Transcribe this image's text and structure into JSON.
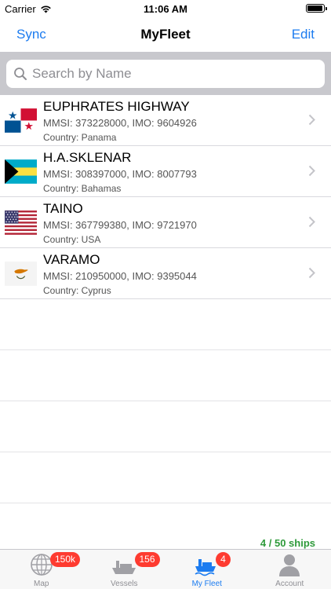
{
  "status": {
    "carrier": "Carrier",
    "time": "11:06 AM"
  },
  "nav": {
    "left": "Sync",
    "title": "MyFleet",
    "right": "Edit"
  },
  "search": {
    "placeholder": "Search by Name",
    "value": ""
  },
  "ships": [
    {
      "name": "EUPHRATES HIGHWAY",
      "ids": "MMSI: 373228000, IMO: 9604926",
      "country": "Country: Panama",
      "flag": "panama-flag"
    },
    {
      "name": "H.A.SKLENAR",
      "ids": "MMSI: 308397000, IMO: 8007793",
      "country": "Country: Bahamas",
      "flag": "bahamas-flag"
    },
    {
      "name": "TAINO",
      "ids": "MMSI: 367799380, IMO: 9721970",
      "country": "Country: USA",
      "flag": "usa-flag"
    },
    {
      "name": "VARAMO",
      "ids": "MMSI: 210950000, IMO: 9395044",
      "country": "Country: Cyprus",
      "flag": "cyprus-flag"
    }
  ],
  "count_text": "4 / 50 ships",
  "tabs": [
    {
      "label": "Map",
      "badge": "150k",
      "icon": "globe-icon",
      "active": false
    },
    {
      "label": "Vessels",
      "badge": "156",
      "icon": "ship-icon",
      "active": false
    },
    {
      "label": "My Fleet",
      "badge": "4",
      "icon": "fleet-icon",
      "active": true
    },
    {
      "label": "Account",
      "badge": "",
      "icon": "person-icon",
      "active": false
    }
  ],
  "colors": {
    "accent": "#1c7cf0",
    "badge": "#fe3b30",
    "count": "#2e9a3a"
  }
}
